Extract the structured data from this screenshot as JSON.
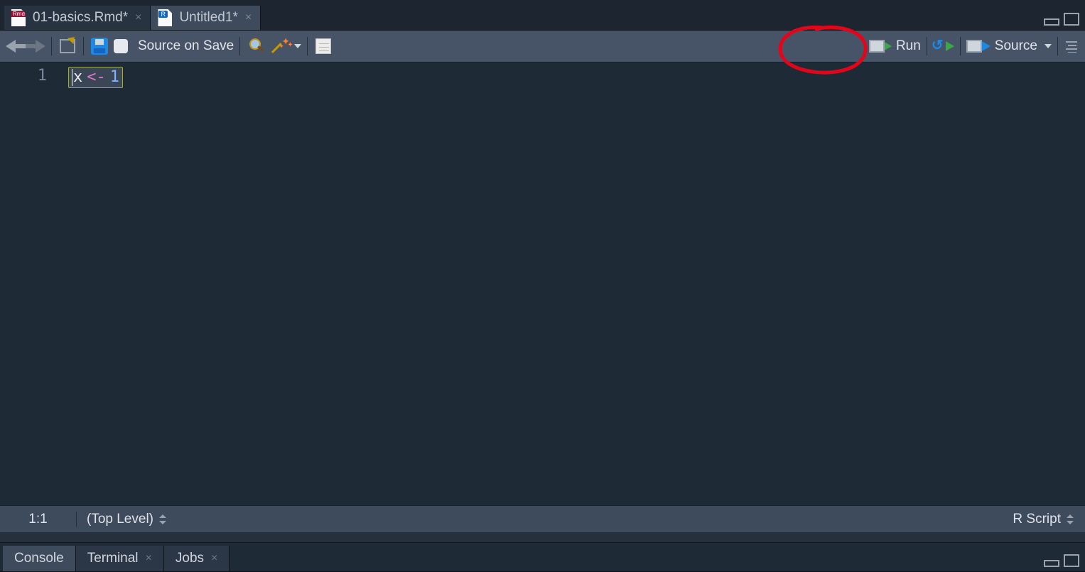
{
  "tabs": {
    "file1": "01-basics.Rmd*",
    "file2": "Untitled1*"
  },
  "toolbar": {
    "source_on_save": "Source on Save",
    "run": "Run",
    "source": "Source"
  },
  "editor": {
    "line_number": "1",
    "token_id": "x",
    "token_op": "<-",
    "token_num": "1"
  },
  "status": {
    "pos": "1:1",
    "scope": "(Top Level)",
    "lang": "R Script"
  },
  "bottom": {
    "console": "Console",
    "terminal": "Terminal",
    "jobs": "Jobs"
  }
}
